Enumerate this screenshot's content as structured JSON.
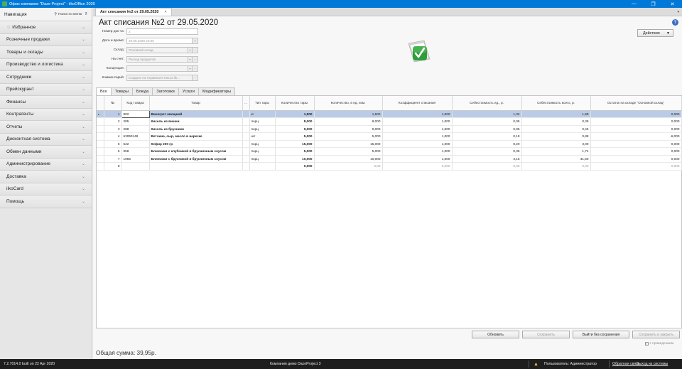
{
  "window": {
    "title": "Офис компании \"Daze Project\" - iikoOffice 2020",
    "controls": [
      "—",
      "❐",
      "✕"
    ]
  },
  "sidebar": {
    "title": "Навигация",
    "search_label": "Поиск по меню",
    "items": [
      {
        "label": "Избранное"
      },
      {
        "label": "Розничные продажи"
      },
      {
        "label": "Товары и склады"
      },
      {
        "label": "Производство и логистика"
      },
      {
        "label": "Сотрудники"
      },
      {
        "label": "Прейскурант"
      },
      {
        "label": "Финансы"
      },
      {
        "label": "Контрагенты"
      },
      {
        "label": "Отчеты"
      },
      {
        "label": "Дисконтная система"
      },
      {
        "label": "Обмен данными"
      },
      {
        "label": "Администрирование"
      },
      {
        "label": "Доставка"
      },
      {
        "label": "iikoCard"
      },
      {
        "label": "Помощь"
      }
    ]
  },
  "document": {
    "tab_label": "Акт списания №2 от 29.05.2020",
    "title": "Акт списания №2 от 29.05.2020",
    "actions_label": "Действия",
    "form": {
      "doc_number": {
        "label": "Номер док-та:",
        "value": "2"
      },
      "datetime": {
        "label": "Дата и время:",
        "value": "29.05.2020 23:00"
      },
      "store": {
        "label": "Склад:",
        "value": "Основной склад"
      },
      "account": {
        "label": "На счет:",
        "value": "Расход продуктов"
      },
      "concept": {
        "label": "Концепция:",
        "value": ""
      },
      "comment": {
        "label": "Комментарий:",
        "value": "Создано на терминале Касса iik..."
      }
    },
    "grid_tabs": [
      "Все",
      "Товары",
      "Блюда",
      "Заготовки",
      "Услуги",
      "Модификаторы"
    ],
    "active_tab": "Все",
    "columns": [
      "№",
      "Код товара",
      "Товар",
      "...",
      "Тип тары",
      "Количество тары",
      "Количество, в ед. изм.",
      "Коэффициент списания",
      "Себестоимость ед., р.",
      "Себестоимость всего, р.",
      "Остаток на складе \"Основной склад\""
    ],
    "rows": [
      {
        "n": "1",
        "code": "802",
        "name": "Винегрет овощной",
        "pack": "кг",
        "qty_pack": "1,500",
        "qty": "1,500",
        "coef": "1,000",
        "cost_unit": "1,32",
        "cost_total": "1,98",
        "stock": "0,000"
      },
      {
        "n": "2",
        "code": "285",
        "name": "Кисель из вишни",
        "pack": "порц",
        "qty_pack": "8,000",
        "qty": "8,000",
        "coef": "1,000",
        "cost_unit": "0,05",
        "cost_total": "0,39",
        "stock": "0,000"
      },
      {
        "n": "3",
        "code": "288",
        "name": "Кисель из брусники",
        "pack": "порц",
        "qty_pack": "9,000",
        "qty": "9,000",
        "coef": "1,000",
        "cost_unit": "0,05",
        "cost_total": "0,46",
        "stock": "0,000"
      },
      {
        "n": "4",
        "code": "63050148",
        "name": "Ветчина, сыр, масло в нарезке",
        "pack": "шт",
        "qty_pack": "5,000",
        "qty": "5,000",
        "coef": "1,000",
        "cost_unit": "0,18",
        "cost_total": "0,88",
        "stock": "-6,000"
      },
      {
        "n": "5",
        "code": "522",
        "name": "Кефир 200 гр",
        "pack": "порц",
        "qty_pack": "15,000",
        "qty": "15,000",
        "coef": "1,000",
        "cost_unit": "0,20",
        "cost_total": "3,00",
        "stock": "0,000"
      },
      {
        "n": "6",
        "code": "958",
        "name": "Блинчики с клубникой и брусничным соусом",
        "pack": "порц",
        "qty_pack": "5,000",
        "qty": "5,000",
        "coef": "1,000",
        "cost_unit": "0,35",
        "cost_total": "1,74",
        "stock": "0,000"
      },
      {
        "n": "7",
        "code": "1056",
        "name": "Блинчики с брусникой и брусничным соусом",
        "pack": "порц",
        "qty_pack": "10,000",
        "qty": "10,000",
        "coef": "1,000",
        "cost_unit": "3,15",
        "cost_total": "31,50",
        "stock": "0,000"
      },
      {
        "n": "8",
        "code": "",
        "name": "",
        "pack": "",
        "qty_pack": "0,000",
        "qty": "0,00",
        "coef": "0,000",
        "cost_unit": "0,00",
        "cost_total": "0,00",
        "stock": "0,000"
      }
    ],
    "buttons": {
      "refresh": "Обновить",
      "save": "Сохранить",
      "exit_no_save": "Выйти без сохранения",
      "save_close": "Сохранить и закрыть"
    },
    "conducted_label": "с проведением",
    "total": "Общая сумма: 39,95р."
  },
  "statusbar": {
    "version": "7.2.7014.0 built on 22 Apr 2020",
    "company": "Компания демо DazeProject 3",
    "user": "Пользователь: Администратор",
    "feedback": "Обратная связь",
    "logout": "Выход из системы"
  }
}
